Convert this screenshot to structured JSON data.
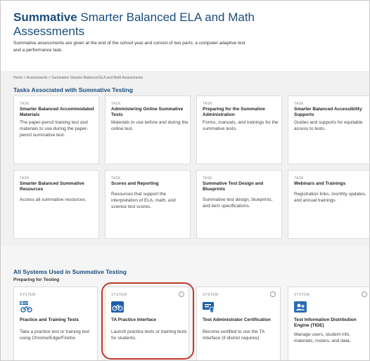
{
  "header": {
    "title_bold": "Summative",
    "title_rest": " Smarter Balanced ELA and Math Assessments",
    "description": "Summative assessments are given at the end of the school year and consist of two parts: a computer adaptive test and a performance task."
  },
  "breadcrumb": "Home > Assessments > Summative Smarter Balanced ELA and Math Assessments",
  "tasks_section": {
    "title": "Tasks Associated with Summative Testing",
    "kind_label": "TASK",
    "cards": [
      {
        "title": "Smarter Balanced Accommodated Materials",
        "description": "The paper-pencil training test and materials to use during the paper-pencil summative test."
      },
      {
        "title": "Administering Online Summative Tests",
        "description": "Materials to use before and during the online test."
      },
      {
        "title": "Preparing for the Summative Administration",
        "description": "Forms, manuals, and trainings for the summative tests."
      },
      {
        "title": "Smarter Balanced Accessibility Supports",
        "description": "Guides and supports for equitable access to tests."
      },
      {
        "title": "Smarter Balanced Summative Resources",
        "description": "Access all summative resources."
      },
      {
        "title": "Scores and Reporting",
        "description": "Resources that support the interpretation of ELA, math, and science test scores."
      },
      {
        "title": "Summative Test Design and Blueprints",
        "description": "Summative test design, blueprints, and item specifications."
      },
      {
        "title": "Webinars and Trainings",
        "description": "Registration links, monthly updates, and annual trainings."
      }
    ]
  },
  "systems_section": {
    "title": "All Systems Used in Summative Testing",
    "subtitle": "Preparing for Testing",
    "kind_label": "SYSTEM",
    "cards": [
      {
        "title": "Practice and Training Tests",
        "description": "Take a practice test or training test using Chrome/Edge/Firefox",
        "icon": "bicycle-icon"
      },
      {
        "title": "TA Practice Interface",
        "description": "Launch practice tests or training tests for students.",
        "icon": "bicycle-icon"
      },
      {
        "title": "Test Administrator Certification",
        "description": "Become certified to use the TA Interface (if district requires)",
        "icon": "certificate-icon"
      },
      {
        "title": "Test Information Distribution Engine (TIDE)",
        "description": "Manage users, student info, materials, rosters, and data.",
        "icon": "users-icon"
      }
    ]
  },
  "colors": {
    "heading": "#1b4d7e",
    "icon_blue": "#2a6db5",
    "highlight": "#c0392b"
  }
}
